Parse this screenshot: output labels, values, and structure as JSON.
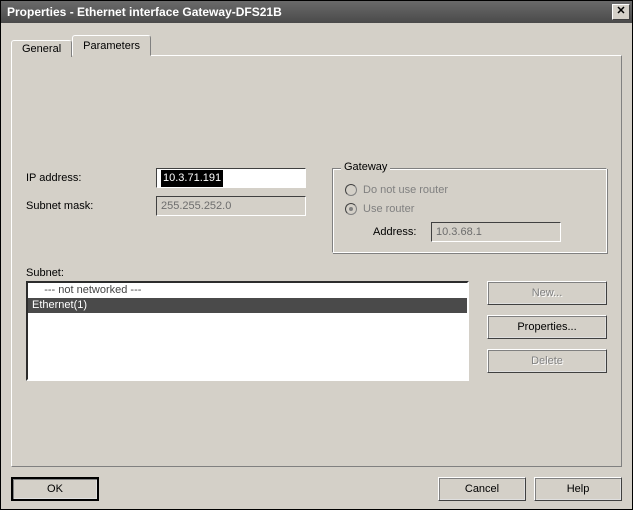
{
  "window": {
    "title": "Properties - Ethernet interface  Gateway-DFS21B",
    "close_glyph": "✕"
  },
  "tabs": {
    "general": "General",
    "parameters": "Parameters"
  },
  "fields": {
    "ip_label": "IP address:",
    "ip_value": "10.3.71.191",
    "mask_label": "Subnet mask:",
    "mask_value": "255.255.252.0"
  },
  "gateway": {
    "caption": "Gateway",
    "opt_no_router": "Do not use router",
    "opt_use_router": "Use router",
    "addr_label": "Address:",
    "addr_value": "10.3.68.1"
  },
  "subnet": {
    "label": "Subnet:",
    "items": [
      {
        "text": "    --- not networked ---",
        "selected": false
      },
      {
        "text": "Ethernet(1)",
        "selected": true
      }
    ]
  },
  "buttons": {
    "new": "New...",
    "properties": "Properties...",
    "delete": "Delete",
    "ok": "OK",
    "cancel": "Cancel",
    "help": "Help"
  }
}
